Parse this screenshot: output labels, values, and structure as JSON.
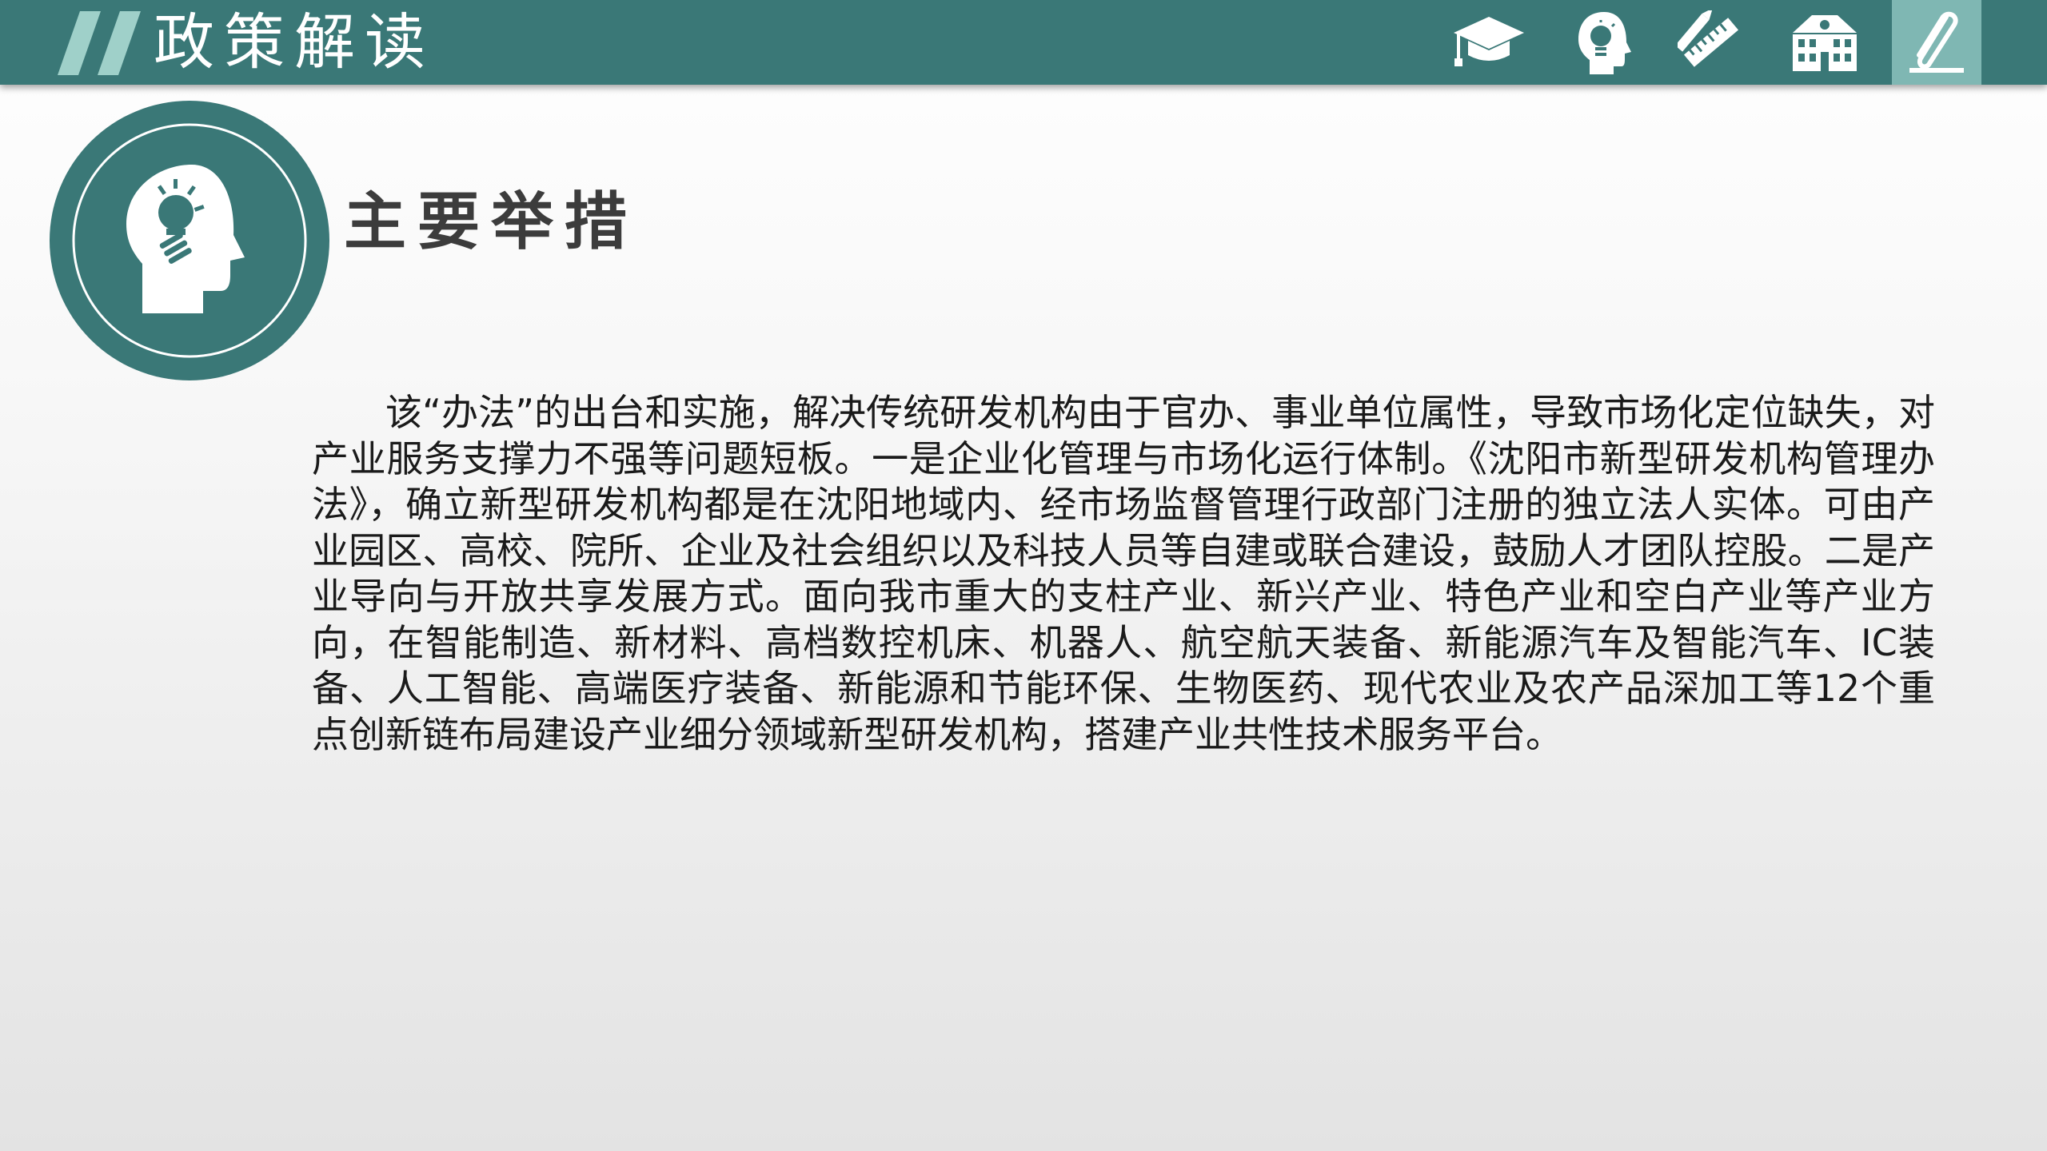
{
  "header": {
    "title": "政策解读"
  },
  "nav": [
    {
      "icon": "graduation-cap-icon"
    },
    {
      "icon": "lightbulb-head-icon"
    },
    {
      "icon": "pencil-ruler-icon"
    },
    {
      "icon": "school-building-icon"
    },
    {
      "icon": "paperclip-icon",
      "active": true
    }
  ],
  "section": {
    "icon": "lightbulb-head-icon",
    "title": "主要举措"
  },
  "body": {
    "paragraph": "该“办法”的出台和实施，解决传统研发机构由于官办、事业单位属性，导致市场化定位缺失，对产业服务支撑力不强等问题短板。一是企业化管理与市场化运行体制。《沈阳市新型研发机构管理办法》，确立新型研发机构都是在沈阳地域内、经市场监督管理行政部门注册的独立法人实体。可由产业园区、高校、院所、企业及社会组织以及科技人员等自建或联合建设，鼓励人才团队控股。二是产业导向与开放共享发展方式。面向我市重大的支柱产业、新兴产业、特色产业和空白产业等产业方向，在智能制造、新材料、高档数控机床、机器人、航空航天装备、新能源汽车及智能汽车、IC装备、人工智能、高端医疗装备、新能源和节能环保、生物医药、现代农业及农产品深加工等12个重点创新链布局建设产业细分领域新型研发机构，搭建产业共性技术服务平台。"
  },
  "colors": {
    "teal": "#3a7877",
    "teal_light": "#7fb7b3",
    "slash": "#9fd0c9",
    "text": "#1a1a1a",
    "title": "#3c3c3c"
  }
}
